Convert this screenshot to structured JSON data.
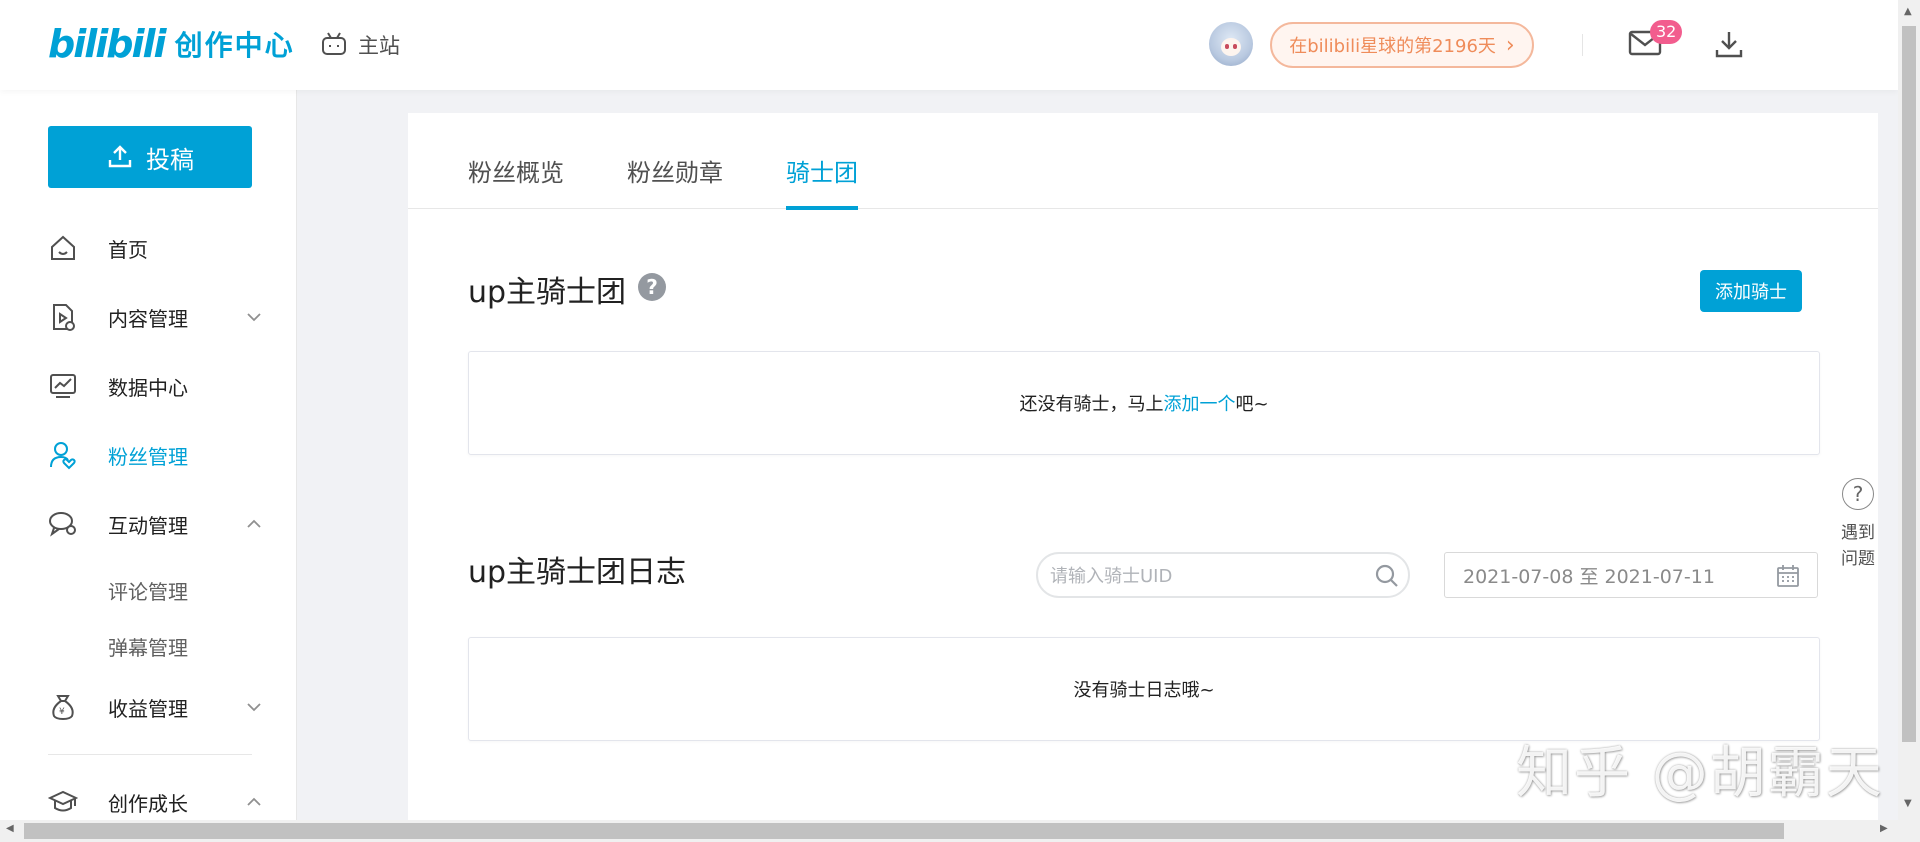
{
  "header": {
    "logo_mark": "bilibili",
    "logo_text": "创作中心",
    "main_site": "主站",
    "planet_text": "在bilibili星球的第2196天",
    "mail_badge": "32",
    "icons": [
      "tv-icon",
      "mail-icon",
      "download-icon",
      "chevron-right-icon"
    ]
  },
  "sidebar": {
    "upload_label": "投稿",
    "items": [
      {
        "label": "首页",
        "icon": "home-icon"
      },
      {
        "label": "内容管理",
        "icon": "content-icon",
        "chevron": "down"
      },
      {
        "label": "数据中心",
        "icon": "chart-icon"
      },
      {
        "label": "粉丝管理",
        "icon": "fans-icon",
        "active": true
      },
      {
        "label": "互动管理",
        "icon": "chat-icon",
        "chevron": "up"
      },
      {
        "label": "收益管理",
        "icon": "money-bag-icon",
        "chevron": "down"
      },
      {
        "label": "创作成长",
        "icon": "graduation-icon",
        "chevron": "up"
      }
    ],
    "sub_items": [
      "评论管理",
      "弹幕管理"
    ]
  },
  "tabs": [
    {
      "label": "粉丝概览"
    },
    {
      "label": "粉丝勋章"
    },
    {
      "label": "骑士团",
      "active": true
    }
  ],
  "knights": {
    "title": "up主骑士团",
    "add_button": "添加骑士",
    "empty_prefix": "还没有骑士，马上 ",
    "empty_link": "添加一个",
    "empty_suffix": "吧~"
  },
  "log": {
    "title": "up主骑士团日志",
    "search_placeholder": "请输入骑士UID",
    "date_range": "2021-07-08 至 2021-07-11",
    "empty_text": "没有骑士日志哦~"
  },
  "float_help": {
    "icon": "?",
    "label_line1": "遇到",
    "label_line2": "问题"
  },
  "watermark": "知乎 @胡霸天",
  "colors": {
    "accent": "#00a1d6",
    "badge": "#f25d8e",
    "planet": "#ef8c5a"
  }
}
